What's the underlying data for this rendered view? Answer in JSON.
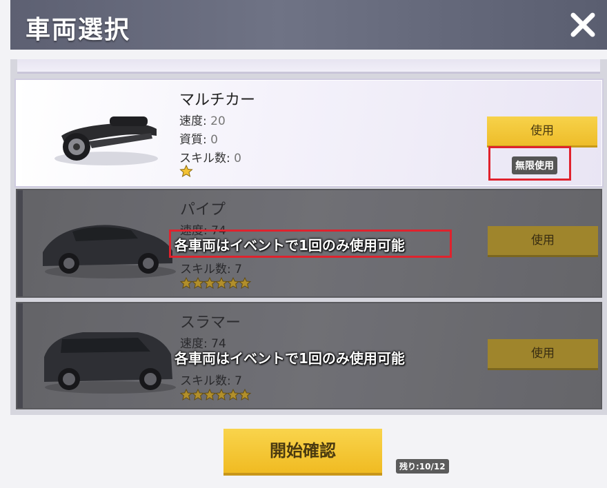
{
  "header": {
    "title": "車両選択"
  },
  "vehicles": [
    {
      "name": "マルチカー",
      "speed_label": "速度:",
      "speed": "20",
      "quality_label": "資質:",
      "quality": "0",
      "skills_label": "スキル数:",
      "skills": "0",
      "stars": 1,
      "use_label": "使用",
      "badge": "無限使用"
    },
    {
      "name": "パイプ",
      "speed_label": "速度:",
      "speed": "74",
      "skills_label": "スキル数:",
      "skills": "7",
      "stars": 6,
      "use_label": "使用",
      "notice": "各車両はイベントで1回のみ使用可能"
    },
    {
      "name": "スラマー",
      "speed_label": "速度:",
      "speed": "74",
      "skills_label": "スキル数:",
      "skills": "7",
      "stars": 6,
      "use_label": "使用",
      "notice": "各車両はイベントで1回のみ使用可能"
    }
  ],
  "footer": {
    "start_label": "開始確認",
    "remaining": "残り:10/12"
  },
  "colors": {
    "accent_yellow": "#f2c12e",
    "highlight_red": "#e0222d",
    "header_bg": "#62667a"
  },
  "icons": {
    "close": "close-x-icon",
    "star": "star-icon"
  }
}
